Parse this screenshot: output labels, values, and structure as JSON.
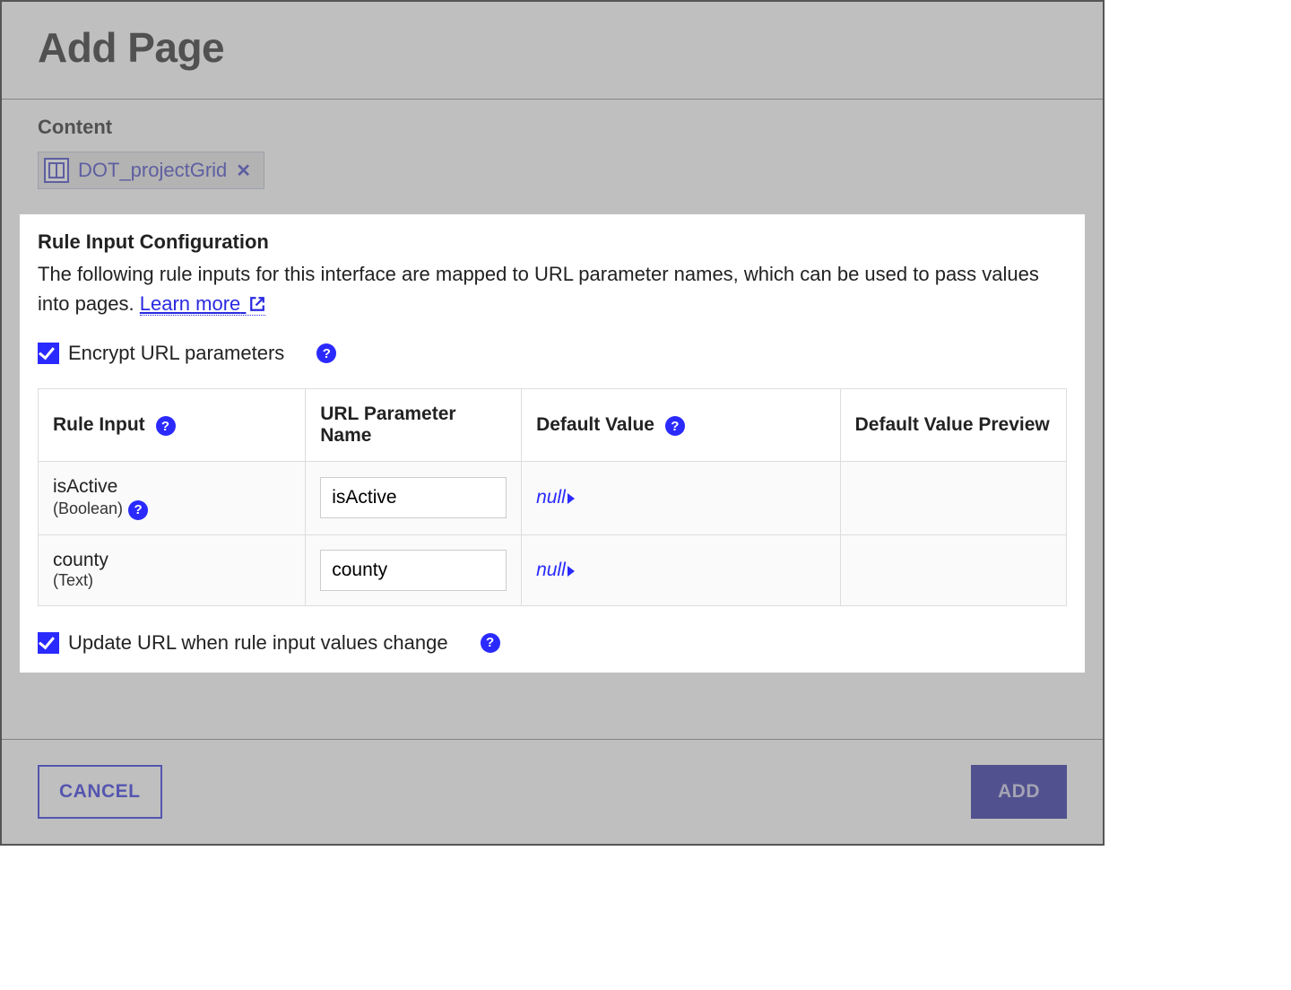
{
  "header": {
    "title": "Add Page"
  },
  "content": {
    "label": "Content",
    "chip_label": "DOT_projectGrid"
  },
  "ruleConfig": {
    "title": "Rule Input Configuration",
    "description": "The following rule inputs for this interface are mapped to URL parameter names, which can be used to pass values into pages. ",
    "learnMore": "Learn more",
    "encryptLabel": "Encrypt URL parameters",
    "updateLabel": "Update URL when rule input values change",
    "columns": {
      "ruleInput": "Rule Input",
      "urlParam": "URL Parameter Name",
      "defaultValue": "Default Value",
      "defaultPreview": "Default Value Preview"
    },
    "rows": [
      {
        "name": "isActive",
        "type": "(Boolean)",
        "url": "isActive",
        "default": "null",
        "preview": ""
      },
      {
        "name": "county",
        "type": "(Text)",
        "url": "county",
        "default": "null",
        "preview": ""
      }
    ]
  },
  "footer": {
    "cancel": "CANCEL",
    "add": "ADD"
  }
}
